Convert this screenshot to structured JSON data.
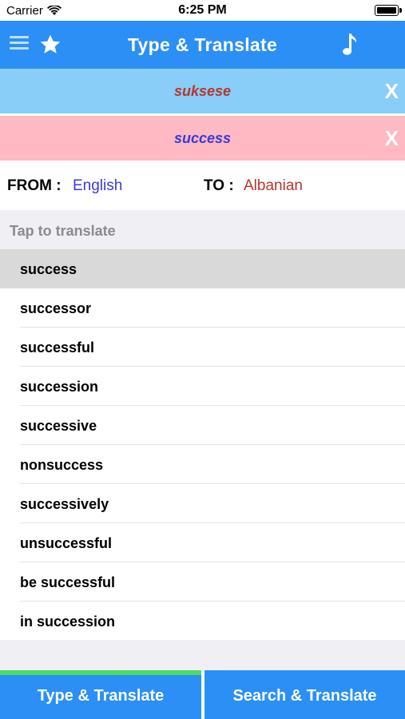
{
  "status_bar": {
    "carrier": "Carrier",
    "time": "6:25 PM"
  },
  "nav": {
    "title": "Type & Translate",
    "icons": {
      "menu": "menu-icon",
      "favorite": "star-icon",
      "audio": "music-note-icon"
    }
  },
  "results": {
    "translation": "suksese",
    "source": "success",
    "clear_label": "X"
  },
  "languages": {
    "from_label": "FROM :",
    "from_value": "English",
    "to_label": "TO :",
    "to_value": "Albanian"
  },
  "suggestions": {
    "header": "Tap to translate",
    "items": [
      "success",
      "successor",
      "successful",
      "succession",
      "successive",
      "nonsuccess",
      "successively",
      "unsuccessful",
      "be successful",
      "in succession"
    ],
    "selected_index": 0
  },
  "tabs": {
    "left": "Type & Translate",
    "right": "Search & Translate",
    "active": "left"
  },
  "colors": {
    "primary_blue": "#2b8ff5",
    "translation_bg": "#89cdf9",
    "source_bg": "#ffb9c3",
    "translation_text": "#b8352a",
    "source_text": "#3a3ad6",
    "active_tab_indicator": "#4cd964"
  }
}
